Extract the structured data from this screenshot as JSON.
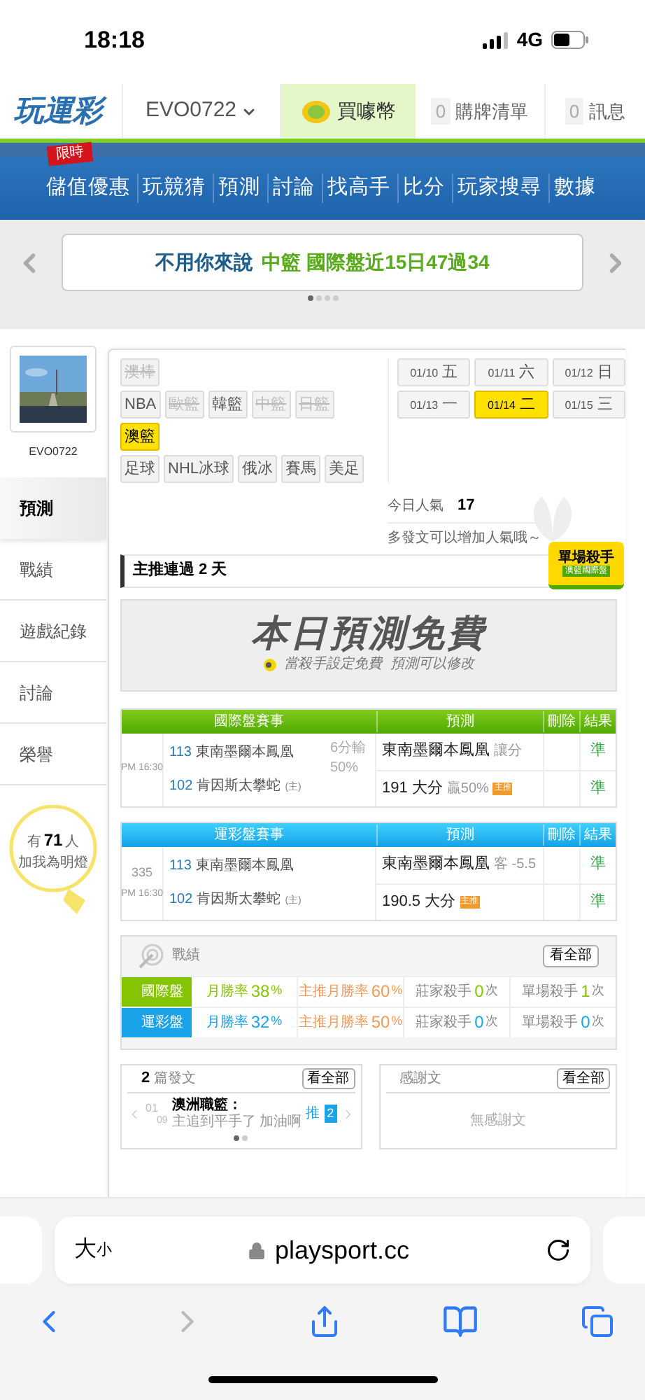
{
  "status_bar": {
    "time": "18:18",
    "network": "4G"
  },
  "header": {
    "logo": "玩運彩",
    "username": "EVO0722",
    "buy_coins": "買噱幣",
    "cart": {
      "count": "0",
      "label": "購牌清單"
    },
    "messages": {
      "count": "0",
      "label": "訊息"
    }
  },
  "nav": {
    "promo_badge": "限時",
    "items": [
      "儲值優惠",
      "玩競猜",
      "預測",
      "討論",
      "找高手",
      "比分",
      "玩家搜尋",
      "數據"
    ]
  },
  "banner": {
    "lead": "不用你來說",
    "highlight": "中籃 國際盤近15日47過34",
    "dots": [
      {
        "selected": true
      },
      {
        "selected": false
      },
      {
        "selected": false
      },
      {
        "selected": false
      }
    ]
  },
  "profile": {
    "name": "EVO0722"
  },
  "sidebar": {
    "items": [
      {
        "label": "預測",
        "selected": true
      },
      {
        "label": "戰績",
        "selected": false
      },
      {
        "label": "遊戲紀錄",
        "selected": false
      },
      {
        "label": "討論",
        "selected": false
      },
      {
        "label": "榮譽",
        "selected": false
      }
    ]
  },
  "fans": {
    "prefix": "有",
    "count": "71",
    "suffix": "人",
    "label": "加我為明燈"
  },
  "sports": [
    [
      {
        "label": "澳棒",
        "disabled": true,
        "selected": false
      }
    ],
    [
      {
        "label": "NBA",
        "disabled": false,
        "selected": false
      },
      {
        "label": "歐籃",
        "disabled": true,
        "selected": false
      },
      {
        "label": "韓籃",
        "disabled": false,
        "selected": false
      },
      {
        "label": "中籃",
        "disabled": true,
        "selected": false
      },
      {
        "label": "日籃",
        "disabled": true,
        "selected": false
      }
    ],
    [
      {
        "label": "澳籃",
        "disabled": false,
        "selected": true
      }
    ],
    [
      {
        "label": "足球",
        "disabled": false,
        "selected": false
      },
      {
        "label": "NHL冰球",
        "disabled": false,
        "selected": false
      },
      {
        "label": "俄冰",
        "disabled": false,
        "selected": false
      },
      {
        "label": "賽馬",
        "disabled": false,
        "selected": false
      },
      {
        "label": "美足",
        "disabled": false,
        "selected": false
      }
    ]
  ],
  "dates": [
    {
      "date": "01/10",
      "weekday": "五",
      "selected": false
    },
    {
      "date": "01/11",
      "weekday": "六",
      "selected": false
    },
    {
      "date": "01/12",
      "weekday": "日",
      "selected": false
    },
    {
      "date": "01/13",
      "weekday": "一",
      "selected": false
    },
    {
      "date": "01/14",
      "weekday": "二",
      "selected": true
    },
    {
      "date": "01/15",
      "weekday": "三",
      "selected": false
    }
  ],
  "popularity": {
    "label": "今日人氣",
    "value": "17",
    "hint": "多發文可以增加人氣哦～"
  },
  "streak": {
    "text": "主推連過 2 天",
    "badge_title": "單場殺手",
    "badge_subtitle": "澳籃國際盤"
  },
  "free_banner": {
    "title": "本日預測免費",
    "subtitle": "當殺手設定免費  預測可以修改"
  },
  "tables": [
    {
      "kind": "international",
      "columns": [
        "國際盤賽事",
        "預測",
        "刪除",
        "結果"
      ],
      "time": "PM 16:30",
      "teams": [
        {
          "no": "113",
          "name": "東南墨爾本鳳凰"
        },
        {
          "no": "102",
          "name": "肯因斯太攀蛇",
          "tag": "(主)"
        }
      ],
      "note": "6分輸 50%",
      "picks": [
        {
          "main": "東南墨爾本鳳凰",
          "detail": "讓分",
          "result": "準"
        },
        {
          "main": "191 大分",
          "detail": "贏50%",
          "badge": "主推",
          "result": "準"
        }
      ]
    },
    {
      "kind": "lottery",
      "columns": [
        "運彩盤賽事",
        "預測",
        "刪除",
        "結果"
      ],
      "game_no": "335",
      "time": "PM 16:30",
      "teams": [
        {
          "no": "113",
          "name": "東南墨爾本鳳凰"
        },
        {
          "no": "102",
          "name": "肯因斯太攀蛇",
          "tag": "(主)"
        }
      ],
      "picks": [
        {
          "main": "東南墨爾本鳳凰",
          "detail": "客 -5.5",
          "result": "準"
        },
        {
          "main": "190.5 大分",
          "badge": "主推",
          "result": "準"
        }
      ]
    }
  ],
  "record": {
    "title": "戰績",
    "button": "看全部",
    "rows": [
      {
        "label": "國際盤",
        "color": "#84c400",
        "stats": [
          {
            "label": "月勝率",
            "value": "38",
            "unit": "%",
            "kind": "rate"
          },
          {
            "label": "主推月勝率",
            "value": "60",
            "unit": "%",
            "kind": "main"
          },
          {
            "label": "莊家殺手",
            "value": "0",
            "unit": "次",
            "kind": "count"
          },
          {
            "label": "單場殺手",
            "value": "1",
            "unit": "次",
            "kind": "count"
          }
        ]
      },
      {
        "label": "運彩盤",
        "color": "#1aa3e8",
        "stats": [
          {
            "label": "月勝率",
            "value": "32",
            "unit": "%",
            "kind": "rate"
          },
          {
            "label": "主推月勝率",
            "value": "50",
            "unit": "%",
            "kind": "main"
          },
          {
            "label": "莊家殺手",
            "value": "0",
            "unit": "次",
            "kind": "count"
          },
          {
            "label": "單場殺手",
            "value": "0",
            "unit": "次",
            "kind": "count"
          }
        ]
      }
    ]
  },
  "posts": {
    "count": "2",
    "label": "篇發文",
    "button": "看全部",
    "item": {
      "month": "01",
      "day": "09",
      "title": "澳洲職籃：",
      "body": "主追到平手了 加油啊",
      "push_label": "推",
      "push_count": "2"
    },
    "dots": [
      {
        "selected": true
      },
      {
        "selected": false
      }
    ]
  },
  "thanks": {
    "title": "感謝文",
    "button": "看全部",
    "empty": "無感謝文"
  },
  "browser": {
    "text_size_big": "大",
    "text_size_small": "小",
    "url": "playsport.cc"
  }
}
